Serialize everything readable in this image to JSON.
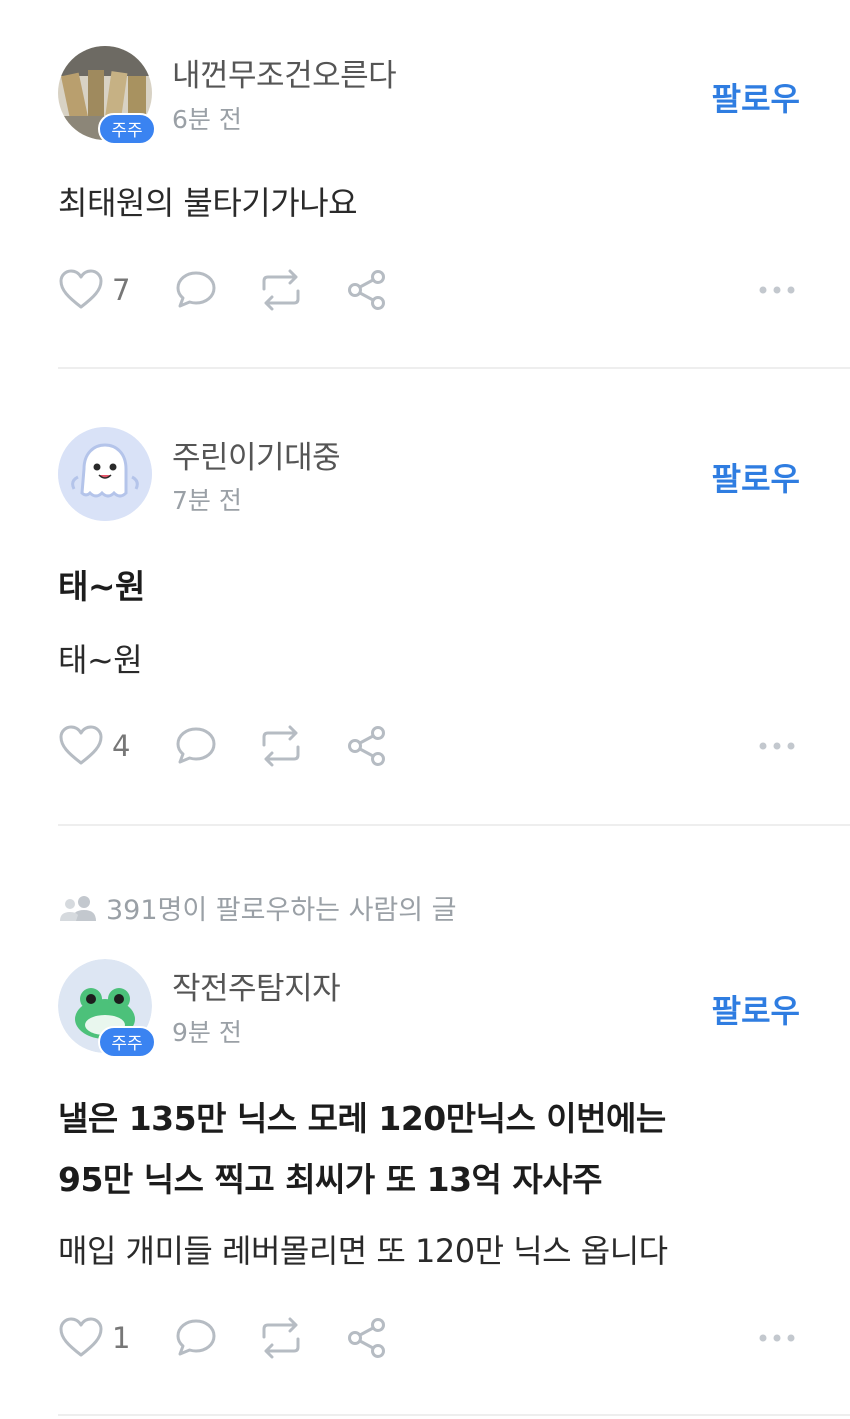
{
  "posts": [
    {
      "username": "내껀무조건오른다",
      "time": "6분 전",
      "badge": "주주",
      "follow": "팔로우",
      "title": "",
      "body": "최태원의 불타기가나요",
      "likes": "7"
    },
    {
      "username": "주린이기대중",
      "time": "7분 전",
      "badge": "",
      "follow": "팔로우",
      "title": "태~원",
      "body": "태~원",
      "likes": "4"
    },
    {
      "notice": "391명이 팔로우하는 사람의 글",
      "username": "작전주탐지자",
      "time": "9분 전",
      "badge": "주주",
      "follow": "팔로우",
      "title_line1": "낼은 135만 닉스 모레 120만닉스 이번에는",
      "title_line2": "95만 닉스 찍고 최씨가 또 13억 자사주",
      "body": "매입 개미들 레버몰리면 또 120만 닉스 옵니다",
      "likes": "1"
    }
  ],
  "icons": {
    "like": "heart-icon",
    "comment": "comment-icon",
    "repost": "repost-icon",
    "share": "share-icon",
    "more": "more-icon",
    "followers": "people-icon"
  },
  "colors": {
    "accent": "#2f7de1",
    "badge": "#3a83f1",
    "icon": "#b6bcc3"
  }
}
